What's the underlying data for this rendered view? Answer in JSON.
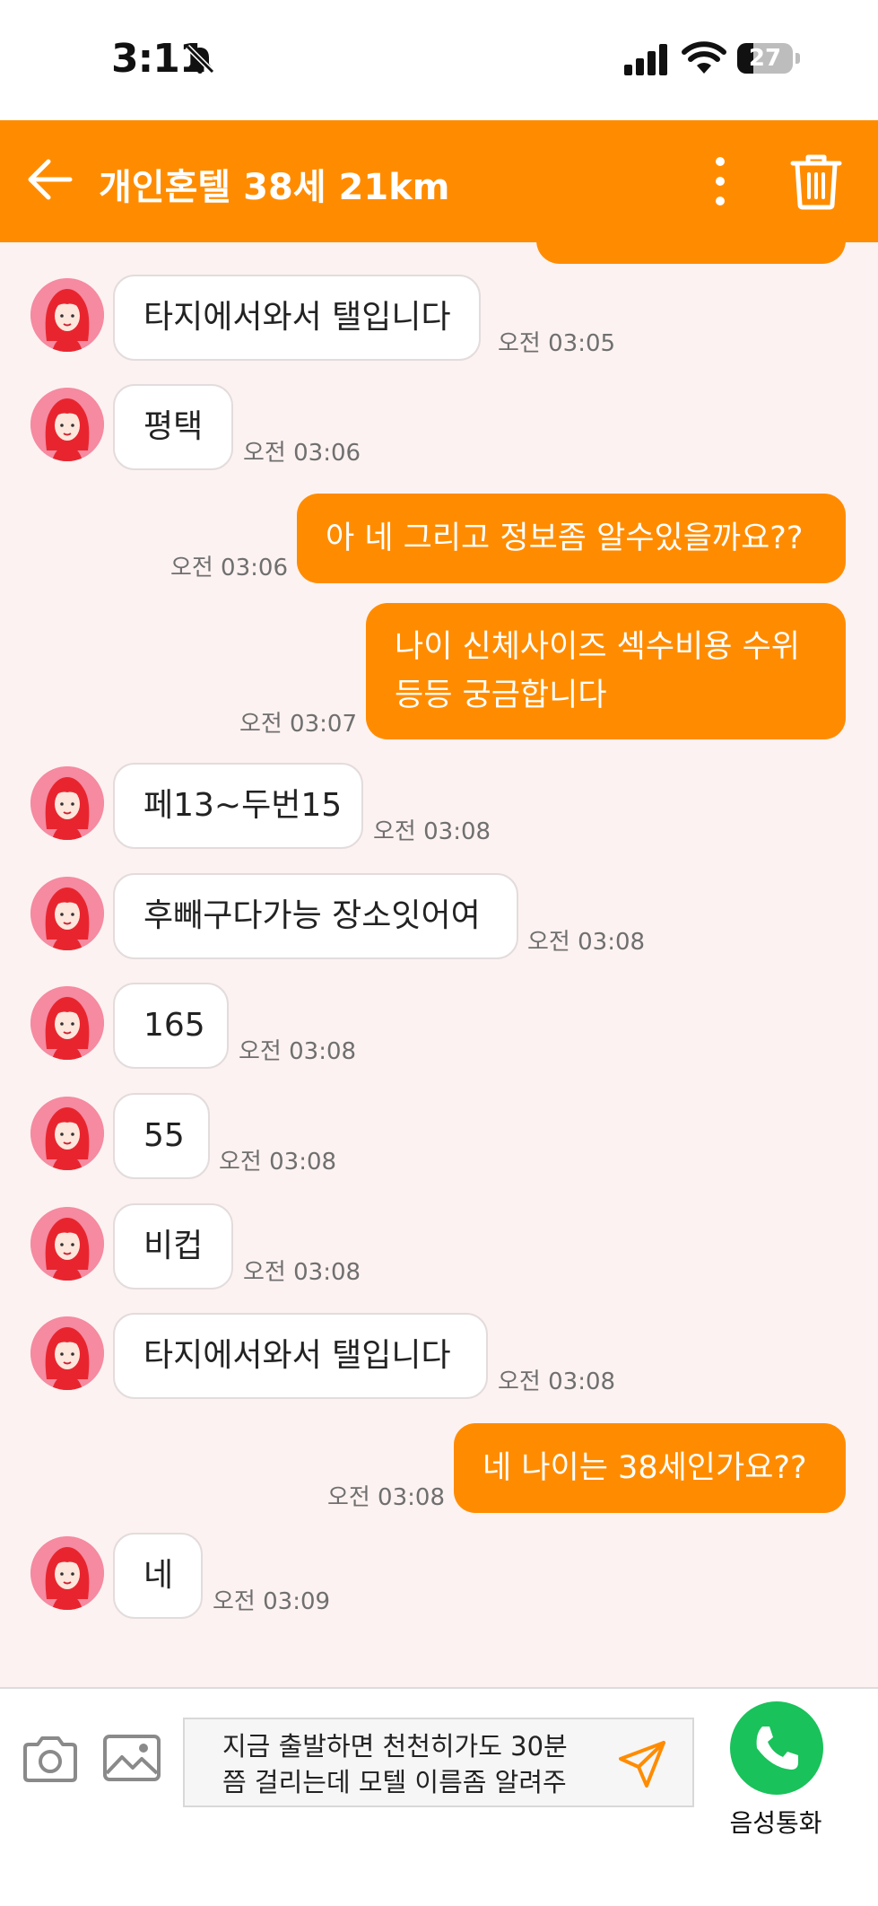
{
  "status_bar": {
    "time": "3:11",
    "battery": "27"
  },
  "header": {
    "title": "개인혼텔 38세 21km"
  },
  "messages": [
    {
      "side": "in",
      "text": "타지에서와서 탤입니다",
      "time": "오전 03:05"
    },
    {
      "side": "in",
      "text": "평택",
      "time": "오전 03:06"
    },
    {
      "side": "out",
      "text": "아 네 그리고 정보좀 알수있을까요??",
      "time": "오전 03:06"
    },
    {
      "side": "out",
      "lines": [
        "나이 신체사이즈 섹수비용 수위",
        "등등 궁금합니다"
      ],
      "time": "오전 03:07"
    },
    {
      "side": "in",
      "text": "페13~두번15",
      "time": "오전 03:08"
    },
    {
      "side": "in",
      "text": "후빼구다가능 장소잇어여",
      "time": "오전 03:08"
    },
    {
      "side": "in",
      "text": "165",
      "time": "오전 03:08"
    },
    {
      "side": "in",
      "text": "55",
      "time": "오전 03:08"
    },
    {
      "side": "in",
      "text": "비컵",
      "time": "오전 03:08"
    },
    {
      "side": "in",
      "text": "타지에서와서 탤입니다",
      "time": "오전 03:08"
    },
    {
      "side": "out",
      "text": "네 나이는 38세인가요??",
      "time": "오전 03:08"
    },
    {
      "side": "in",
      "text": "네",
      "time": "오전 03:09"
    }
  ],
  "input": {
    "lines": [
      "지금 출발하면 천천히가도 30분",
      "쯤 걸리는데 모텔 이름좀 알려주"
    ]
  },
  "call": {
    "label": "음성통화"
  },
  "colors": {
    "accent": "#ff8c00",
    "chat_bg": "#fcf2f1",
    "call_green": "#19c25a"
  },
  "icons": [
    "bell-slash-icon",
    "signal-icon",
    "wifi-icon",
    "battery-icon",
    "back-arrow-icon",
    "more-vertical-icon",
    "trash-icon",
    "camera-icon",
    "gallery-icon",
    "send-icon",
    "phone-icon"
  ]
}
